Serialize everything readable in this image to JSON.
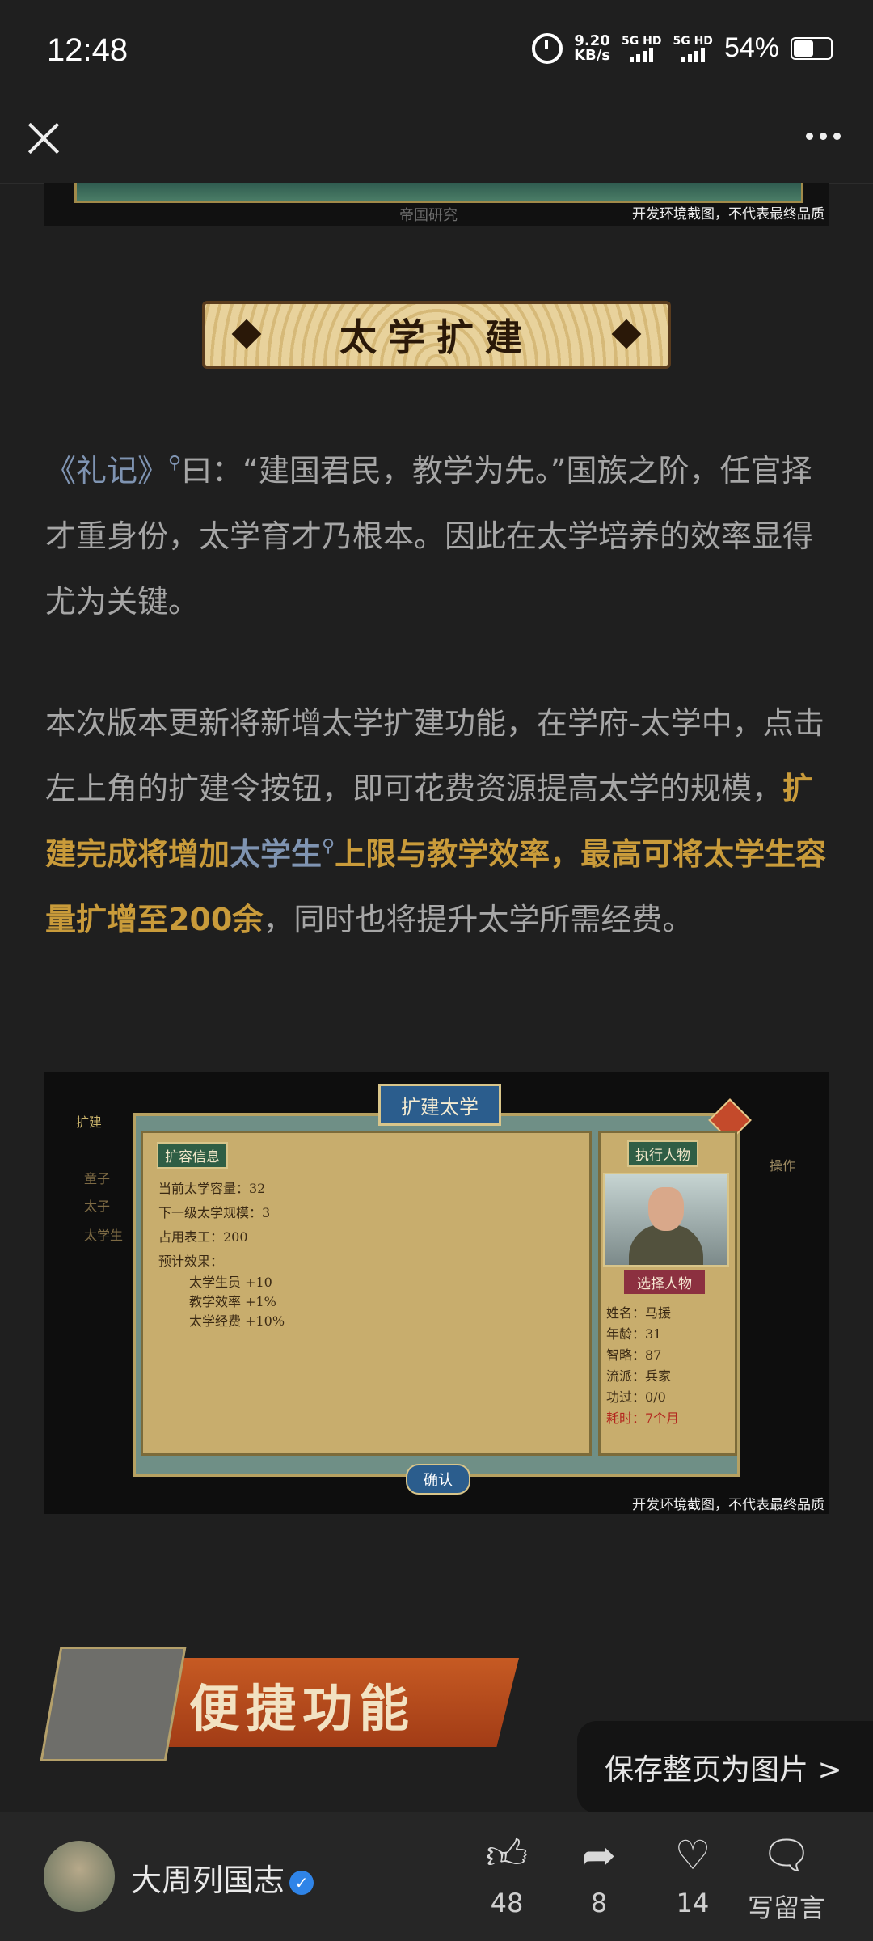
{
  "status_bar": {
    "time": "12:48",
    "net_speed_value": "9.20",
    "net_speed_unit": "KB/s",
    "sim1": "5G HD",
    "sim2": "5G HD",
    "battery": "54%"
  },
  "top_bar": {
    "close_icon": "close-icon",
    "more_icon": "more-icon"
  },
  "top_image": {
    "tab_text": "帝国研究",
    "caption": "开发环境截图，不代表最终品质"
  },
  "section_banner": {
    "title": "太学扩建"
  },
  "paragraph1": {
    "link": "《礼记》",
    "text": "曰：“建国君民，教学为先。”国族之阶，任官择才重身份，太学育才乃根本。因此在太学培养的效率显得尤为关键。"
  },
  "paragraph2": {
    "part1": "本次版本更新将新增太学扩建功能，在学府-太学中，点击左上角的扩建令按钮，即可花费资源提高太学的规模，",
    "hl1": "扩建完成将增加",
    "link": "太学生",
    "hl2": "上限与教学效率，最高可将太学生容量扩增至200余",
    "part2": "，同时也将提升太学所需经费。"
  },
  "game_screenshot": {
    "title": "扩建太学",
    "info_tag": "扩容信息",
    "lines": [
      "当前太学容量：32",
      "下一级太学规模：3",
      "占用表工：200",
      "预计效果：",
      "太学生员 +10",
      "教学效率 +1%",
      "太学经费 +10%"
    ],
    "exec_tag": "执行人物",
    "pick_button": "选择人物",
    "person": [
      "姓名：马援",
      "年龄：31",
      "智略：87",
      "流派：兵家",
      "功过：0/0",
      "耗时：7个月"
    ],
    "confirm": "确认",
    "left_items": [
      "扩建",
      "童子",
      "太子",
      "太学生"
    ],
    "col_header": "操作",
    "caption": "开发环境截图，不代表最终品质"
  },
  "section2": {
    "title": "便捷功能"
  },
  "save_button": "保存整页为图片 >",
  "bottom_bar": {
    "account_name": "大周列国志",
    "likes": "48",
    "shares": "8",
    "favorites": "14",
    "comment_label": "写留言"
  }
}
